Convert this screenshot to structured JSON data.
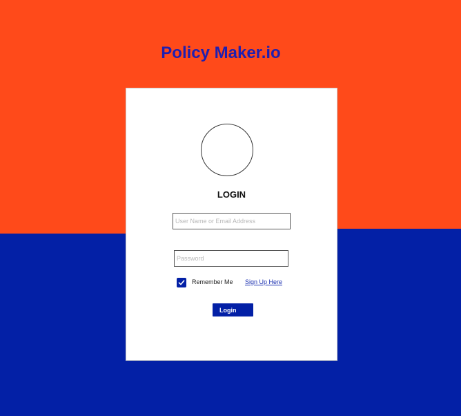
{
  "app": {
    "title": "Policy Maker.io"
  },
  "login_form": {
    "heading": "LOGIN",
    "username": {
      "placeholder": "User Name or Email Address",
      "value": ""
    },
    "password": {
      "placeholder": "Password",
      "value": ""
    },
    "remember_me": {
      "label": "Remember Me",
      "checked": true
    },
    "signup_link": "Sign Up Here",
    "submit_label": "Login"
  },
  "icons": {
    "avatar": "avatar-placeholder-circle",
    "checkbox": "checkmark-icon"
  },
  "colors": {
    "top_background": "#FF4A1A",
    "bottom_background": "#0320A6",
    "title": "#1F1FB0",
    "accent": "#0320A6",
    "link": "#1A2FB0"
  }
}
